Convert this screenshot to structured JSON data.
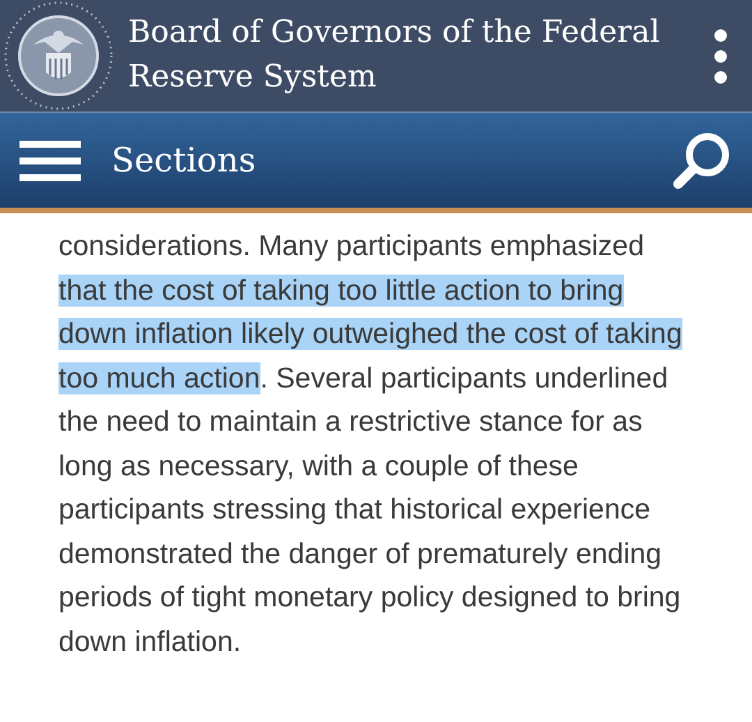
{
  "header": {
    "title": "Board of Governors of the Federal Reserve System"
  },
  "nav": {
    "label": "Sections"
  },
  "article": {
    "segments": [
      {
        "text": "considerations. Many participants emphasized ",
        "highlighted": false
      },
      {
        "text": "that the cost of taking too little action to bring down inflation likely outweighed the cost of taking too much action",
        "highlighted": true
      },
      {
        "text": ". Several participants underlined the need to maintain a restrictive stance for as long as necessary, with a couple of these participants stressing that historical experience demonstrated the danger of prematurely ending periods of tight monetary policy designed to bring down inflation.",
        "highlighted": false
      }
    ]
  }
}
